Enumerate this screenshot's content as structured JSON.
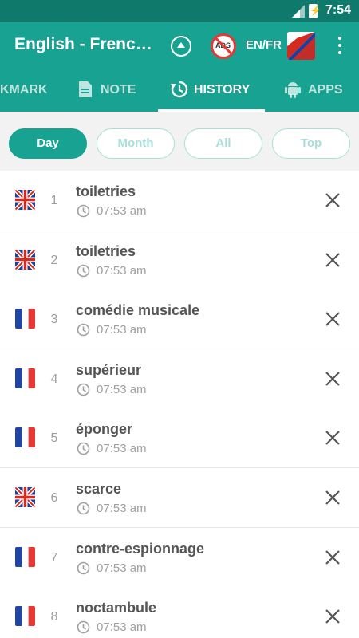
{
  "status_bar": {
    "time": "7:54",
    "battery_glyph": "⚡"
  },
  "app_bar": {
    "title": "English - French…",
    "ads_label": "ADS",
    "language_pair": "EN/FR"
  },
  "tabs": [
    {
      "label": "KMARK",
      "icon": "bookmark-icon"
    },
    {
      "label": "NOTE",
      "icon": "note-icon"
    },
    {
      "label": "HISTORY",
      "icon": "history-icon",
      "active": true
    },
    {
      "label": "APPS",
      "icon": "android-icon"
    }
  ],
  "filters": [
    {
      "label": "Day",
      "active": true
    },
    {
      "label": "Month"
    },
    {
      "label": "All"
    },
    {
      "label": "Top"
    }
  ],
  "history": [
    {
      "index": "1",
      "word": "toiletries",
      "time": "07:53 am",
      "flag": "uk"
    },
    {
      "index": "2",
      "word": "toiletries",
      "time": "07:53 am",
      "flag": "uk"
    },
    {
      "index": "3",
      "word": "comédie musicale",
      "time": "07:53 am",
      "flag": "fr"
    },
    {
      "index": "4",
      "word": "supérieur",
      "time": "07:53 am",
      "flag": "fr"
    },
    {
      "index": "5",
      "word": "éponger",
      "time": "07:53 am",
      "flag": "fr"
    },
    {
      "index": "6",
      "word": "scarce",
      "time": "07:53 am",
      "flag": "uk"
    },
    {
      "index": "7",
      "word": "contre-espionnage",
      "time": "07:53 am",
      "flag": "fr"
    },
    {
      "index": "8",
      "word": "noctambule",
      "time": "07:53 am",
      "flag": "fr"
    }
  ],
  "colors": {
    "primary": "#17a291",
    "primary_dark": "#0f7a6c",
    "chip_inactive": "#a8e0d9",
    "delete_icon": "#555555"
  }
}
